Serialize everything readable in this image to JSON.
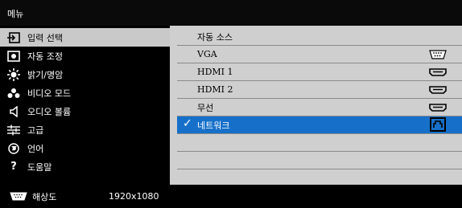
{
  "title": "메뉴",
  "menu": [
    {
      "label": "입력 선택",
      "icon": "input-select-icon",
      "selected": true
    },
    {
      "label": "자동 조정",
      "icon": "auto-adjust-icon",
      "selected": false
    },
    {
      "label": "밝기/명암",
      "icon": "brightness-icon",
      "selected": false
    },
    {
      "label": "비디오 모드",
      "icon": "video-mode-icon",
      "selected": false
    },
    {
      "label": "오디오 볼륨",
      "icon": "speaker-icon",
      "selected": false
    },
    {
      "label": "고급",
      "icon": "advanced-settings-icon",
      "selected": false
    },
    {
      "label": "언어",
      "icon": "globe-icon",
      "selected": false
    },
    {
      "label": "도움말",
      "icon": "help-icon",
      "selected": false
    }
  ],
  "sources": [
    {
      "label": "자동 소스",
      "icon": ""
    },
    {
      "label": "VGA",
      "icon": "vga-port-icon"
    },
    {
      "label": "HDMI 1",
      "icon": "hdmi-port-icon"
    },
    {
      "label": "HDMI 2",
      "icon": "hdmi-port-icon"
    },
    {
      "label": "무선",
      "icon": "hdmi-port-icon"
    },
    {
      "label": "네트워크",
      "icon": "network-port-icon",
      "checked": true
    }
  ],
  "status": {
    "resolution_label": "해상도",
    "resolution_value": "1920x1080"
  },
  "colors": {
    "highlight": "#1670c9",
    "panel": "#cfcfcf",
    "selected_menu": "#c9c9c9"
  }
}
